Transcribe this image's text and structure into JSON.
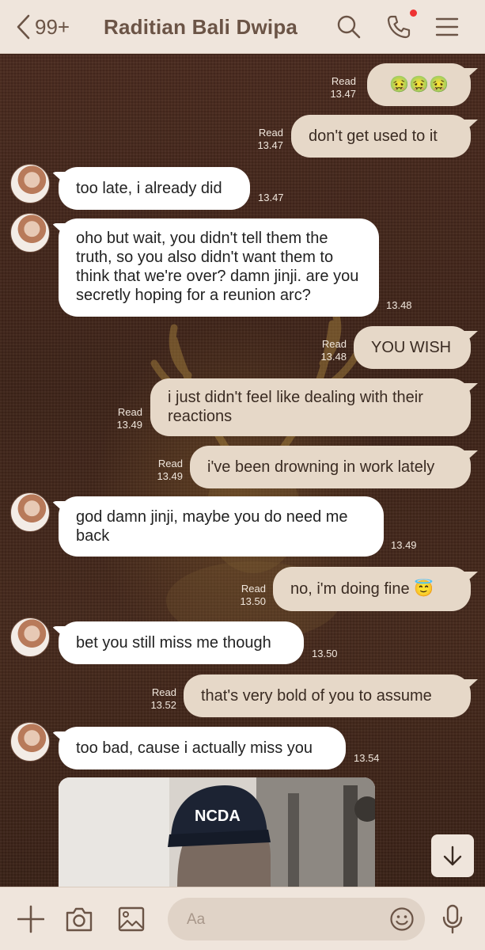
{
  "header": {
    "unread_count": "99+",
    "contact_name": "Raditian Bali Dwipa"
  },
  "messages": [
    {
      "dir": "out",
      "text": "🤢🤢🤢",
      "read": "Read",
      "time": "13.47"
    },
    {
      "dir": "out",
      "text": "don't get used to it",
      "read": "Read",
      "time": "13.47"
    },
    {
      "dir": "in",
      "text": "too late, i already did",
      "time": "13.47"
    },
    {
      "dir": "in",
      "text": "oho but wait, you didn't tell them the truth, so you also didn't want them to think that we're over? damn jinji. are you secretly hoping for a reunion arc?",
      "time": "13.48"
    },
    {
      "dir": "out",
      "text": "YOU WISH",
      "read": "Read",
      "time": "13.48"
    },
    {
      "dir": "out",
      "text": "i just didn't feel like dealing with their reactions",
      "read": "Read",
      "time": "13.49"
    },
    {
      "dir": "out",
      "text": "i've been drowning in work lately",
      "read": "Read",
      "time": "13.49"
    },
    {
      "dir": "in",
      "text": "god damn jinji, maybe you do need me back",
      "time": "13.49"
    },
    {
      "dir": "out",
      "text": "no, i'm doing fine 😇",
      "read": "Read",
      "time": "13.50"
    },
    {
      "dir": "in",
      "text": "bet you still miss me though",
      "time": "13.50"
    },
    {
      "dir": "out",
      "text": "that's very bold of you to assume",
      "read": "Read",
      "time": "13.52"
    },
    {
      "dir": "in",
      "text": "too bad, cause i actually miss you",
      "time": "13.54"
    }
  ],
  "footer": {
    "input_placeholder": "Aa"
  },
  "icons": {
    "back": "chevron-left-icon",
    "search": "search-icon",
    "call": "phone-icon",
    "menu": "menu-icon",
    "add": "plus-icon",
    "camera": "camera-icon",
    "gallery": "image-icon",
    "emoji": "emoji-icon",
    "mic": "microphone-icon",
    "scroll": "arrow-down-icon"
  },
  "colors": {
    "header_bg": "#efe5dc",
    "header_text": "#6b5446",
    "incoming_bubble": "#ffffff",
    "outgoing_bubble": "#e6d8c8",
    "notification_dot": "#e33333",
    "chat_bg": "#3e2419"
  }
}
